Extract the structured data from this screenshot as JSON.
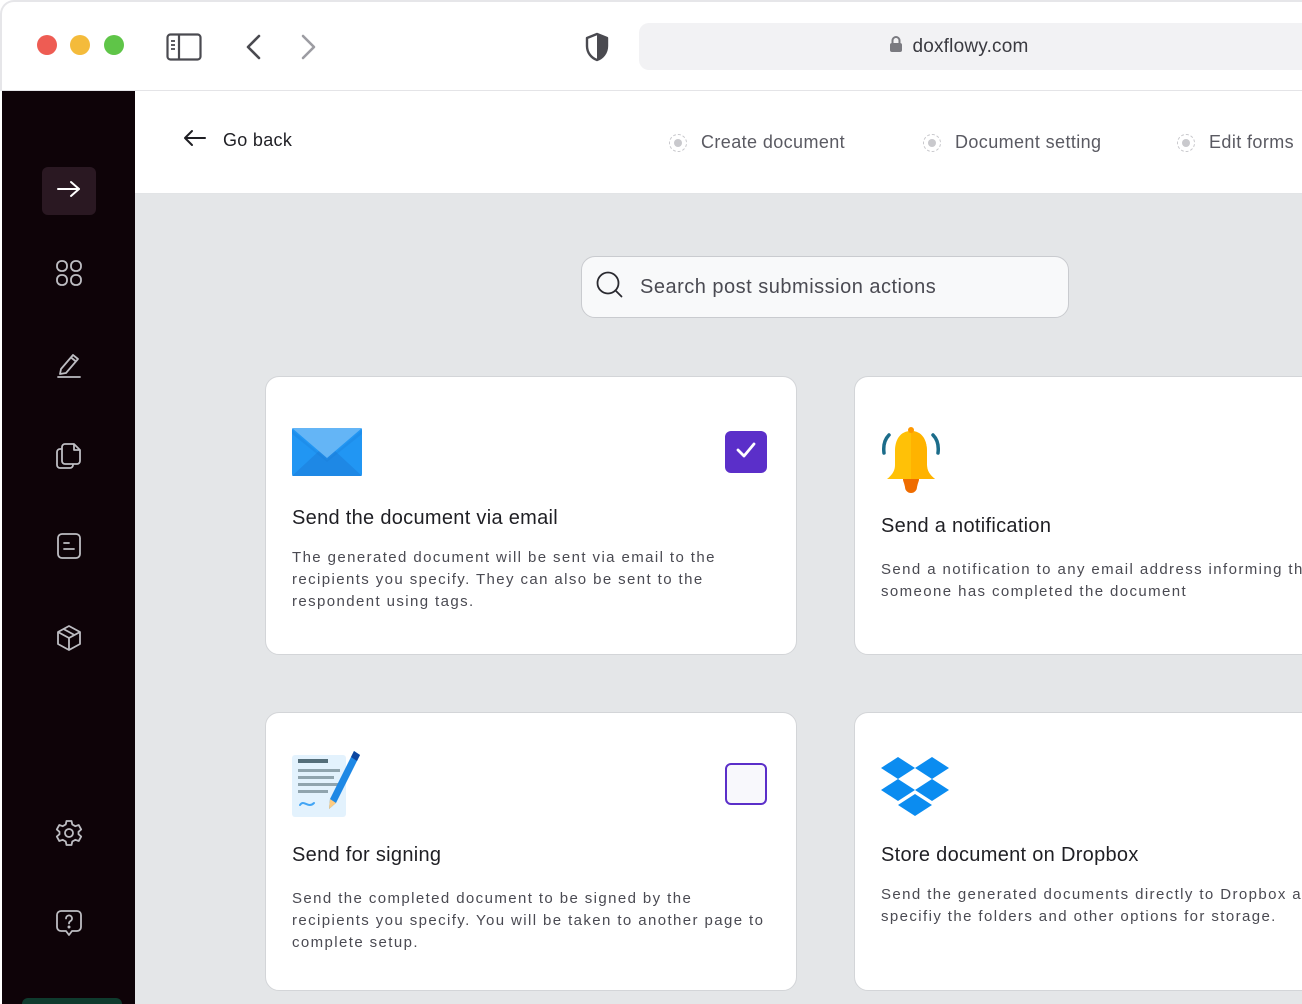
{
  "browser": {
    "url": "doxflowy.com"
  },
  "topnav": {
    "go_back": "Go back",
    "steps": [
      {
        "label": "Create document"
      },
      {
        "label": "Document setting"
      },
      {
        "label": "Edit forms"
      }
    ]
  },
  "search": {
    "placeholder": "Search post submission actions"
  },
  "cards": [
    {
      "title": "Send the document via email",
      "description": "The generated document will be sent via email to the recipients you specify. They can also be sent to the respondent using tags.",
      "icon": "email-envelope-icon",
      "checked": true
    },
    {
      "title": "Send a notification",
      "description": "Send a notification to any email address informing them that someone has completed the document",
      "icon": "bell-icon",
      "checked": false
    },
    {
      "title": "Send for signing",
      "description": "Send the completed document to be signed by the recipients you specify. You will be taken to another page to complete setup.",
      "icon": "signing-document-icon",
      "checked": false
    },
    {
      "title": "Store document on Dropbox",
      "description": "Send the generated documents directly to Dropbox and specifiy the folders and other options for storage.",
      "icon": "dropbox-icon",
      "checked": false
    }
  ],
  "colors": {
    "sidebar": "#0e0308",
    "accent": "#5b2fc9",
    "background": "#e4e6e8"
  }
}
